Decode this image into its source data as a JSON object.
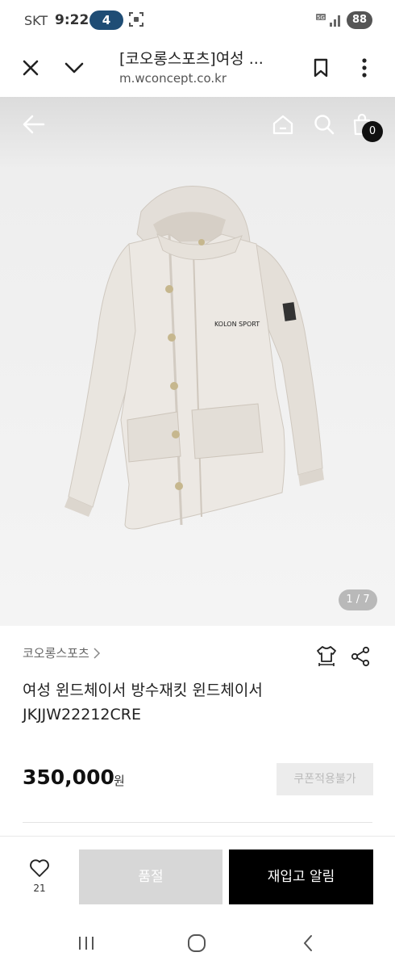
{
  "status_bar": {
    "carrier": "SKT",
    "time": "9:22",
    "notification_count": "4",
    "network": "5G",
    "battery": "88"
  },
  "browser": {
    "title": "[코오롱스포츠]여성 ...",
    "url": "m.wconcept.co.kr",
    "icons": [
      "close-icon",
      "chevron-down-icon",
      "bookmark-icon",
      "more-vertical-icon"
    ]
  },
  "header": {
    "icons": [
      "back-arrow-icon",
      "home-icon",
      "search-icon",
      "cart-icon"
    ],
    "cart_count": "0"
  },
  "gallery": {
    "counter": "1 / 7",
    "jacket_logo": "KOLON SPORT",
    "colors": {
      "jacket": "#ece8e3",
      "shadow": "#d7d1ca",
      "button": "#c6b78e"
    }
  },
  "product": {
    "brand": "코오롱스포츠",
    "name_line1": "여성 윈드체이서 방수재킷 윈드체이서",
    "name_line2": "JKJJW22212CRE",
    "price": "350,000",
    "currency": "원",
    "coupon_label": "쿠폰적용불가"
  },
  "actions": {
    "like_count": "21",
    "soldout_label": "품절",
    "restock_label": "재입고 알림"
  }
}
